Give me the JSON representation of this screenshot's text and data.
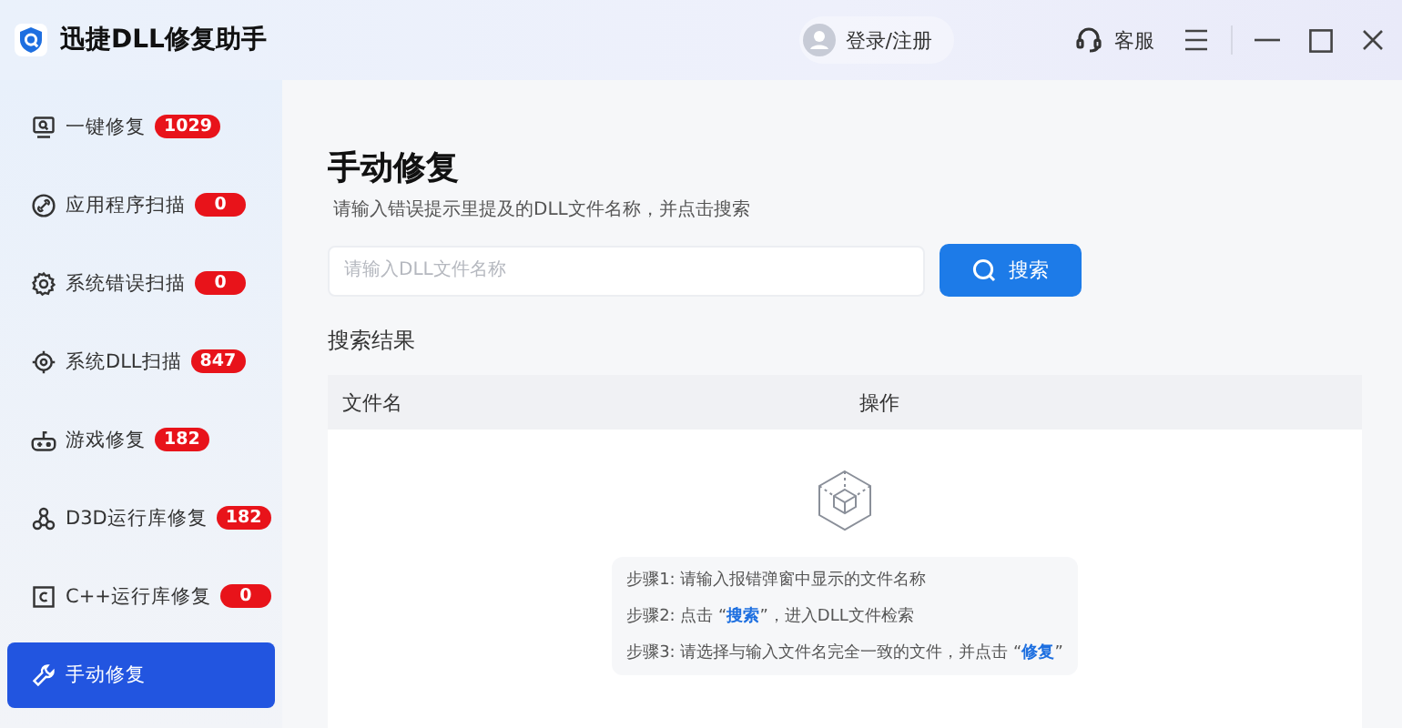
{
  "window": {
    "title": "迅捷DLL修复助手"
  },
  "header": {
    "login": "登录/注册",
    "support": "客服"
  },
  "sidebar": {
    "items": [
      {
        "label": "一键修复",
        "count": "1029",
        "selected": false
      },
      {
        "label": "应用程序扫描",
        "count": "0",
        "selected": false
      },
      {
        "label": "系统错误扫描",
        "count": "0",
        "selected": false
      },
      {
        "label": "系统DLL扫描",
        "count": "847",
        "selected": false
      },
      {
        "label": "游戏修复",
        "count": "182",
        "selected": false
      },
      {
        "label": "D3D运行库修复",
        "count": "182",
        "selected": false
      },
      {
        "label": "C++运行库修复",
        "count": "0",
        "selected": false
      },
      {
        "label": "手动修复",
        "selected": true
      }
    ]
  },
  "main": {
    "title": "手动修复",
    "subtitle": "请输入错误提示里提及的DLL文件名称，并点击搜索",
    "search": {
      "placeholder": "请输入DLL文件名称",
      "button": "搜索"
    },
    "results_title": "搜索结果",
    "table": {
      "columns": [
        "文件名",
        "操作"
      ]
    },
    "steps": [
      [
        {
          "kind": "text",
          "text": "步骤1: 请输入报错弹窗中显示的文件名称"
        }
      ],
      [
        {
          "kind": "text",
          "text": "步骤2: 点击 “"
        },
        {
          "kind": "link",
          "text": "搜索"
        },
        {
          "kind": "text",
          "text": "”，进入DLL文件检索"
        }
      ],
      [
        {
          "kind": "text",
          "text": "步骤3: 请选择与输入文件名完全一致的文件，并点击 “"
        },
        {
          "kind": "link",
          "text": "修复"
        },
        {
          "kind": "text",
          "text": "”"
        }
      ]
    ]
  }
}
